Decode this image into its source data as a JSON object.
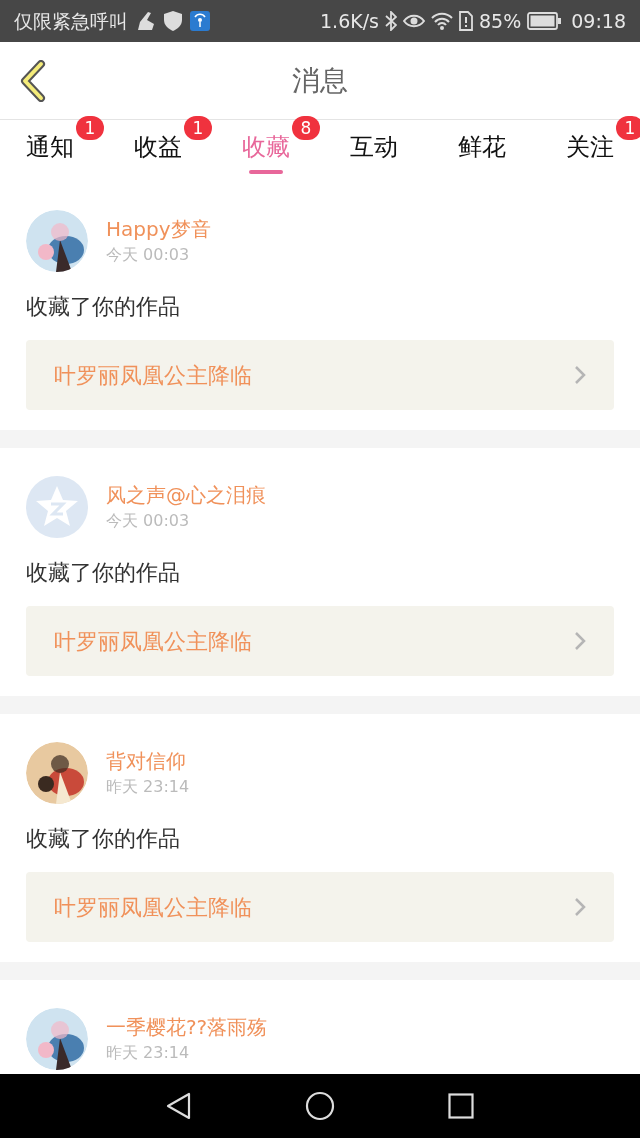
{
  "status_bar": {
    "carrier": "仅限紧急呼叫",
    "speed": "1.6K/s",
    "battery": "85%",
    "time": "09:18"
  },
  "header": {
    "title": "消息"
  },
  "tabs": [
    {
      "label": "通知",
      "badge": "1",
      "selected": false
    },
    {
      "label": "收益",
      "badge": "1",
      "selected": false
    },
    {
      "label": "收藏",
      "badge": "8",
      "selected": true
    },
    {
      "label": "互动",
      "selected": false
    },
    {
      "label": "鲜花",
      "selected": false
    },
    {
      "label": "关注",
      "badge": "1",
      "selected": false
    }
  ],
  "messages": [
    {
      "user": "Happy梦音",
      "time": "今天 00:03",
      "text": "收藏了你的作品",
      "work": "叶罗丽凤凰公主降临"
    },
    {
      "user": "风之声@心之泪痕",
      "time": "今天 00:03",
      "text": "收藏了你的作品",
      "work": "叶罗丽凤凰公主降临",
      "avatar": {
        "kind": "default"
      }
    },
    {
      "user": "背对信仰",
      "time": "昨天 23:14",
      "text": "收藏了你的作品",
      "work": "叶罗丽凤凰公主降临"
    },
    {
      "user": "一季樱花??落雨殇",
      "time": "昨天 23:14"
    }
  ]
}
